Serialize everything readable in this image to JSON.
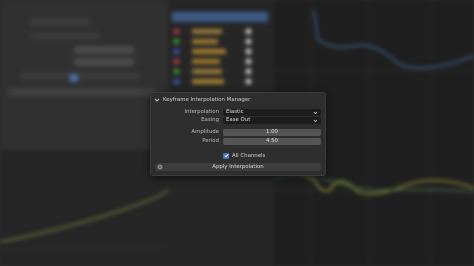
{
  "panel": {
    "title": "Keyframe Interpolation Manager",
    "interpolation": {
      "label": "Interpolation",
      "value": "Elastic"
    },
    "easing": {
      "label": "Easing",
      "value": "Ease Out"
    },
    "amplitude": {
      "label": "Amplitude",
      "value": "1.00"
    },
    "period": {
      "label": "Period",
      "value": "4.50"
    },
    "all_channels": {
      "label": "All Channels",
      "checked": true
    },
    "apply_label": "Apply Interpolation"
  },
  "colors": {
    "accent": "#4772b3",
    "panel_bg": "#2e2e2e",
    "dropdown_bg": "#1d1d1d",
    "number_bg": "#545454"
  },
  "icons": [
    "chevron-down-icon",
    "caret-down-icon",
    "checkmark-icon",
    "gear-icon"
  ]
}
